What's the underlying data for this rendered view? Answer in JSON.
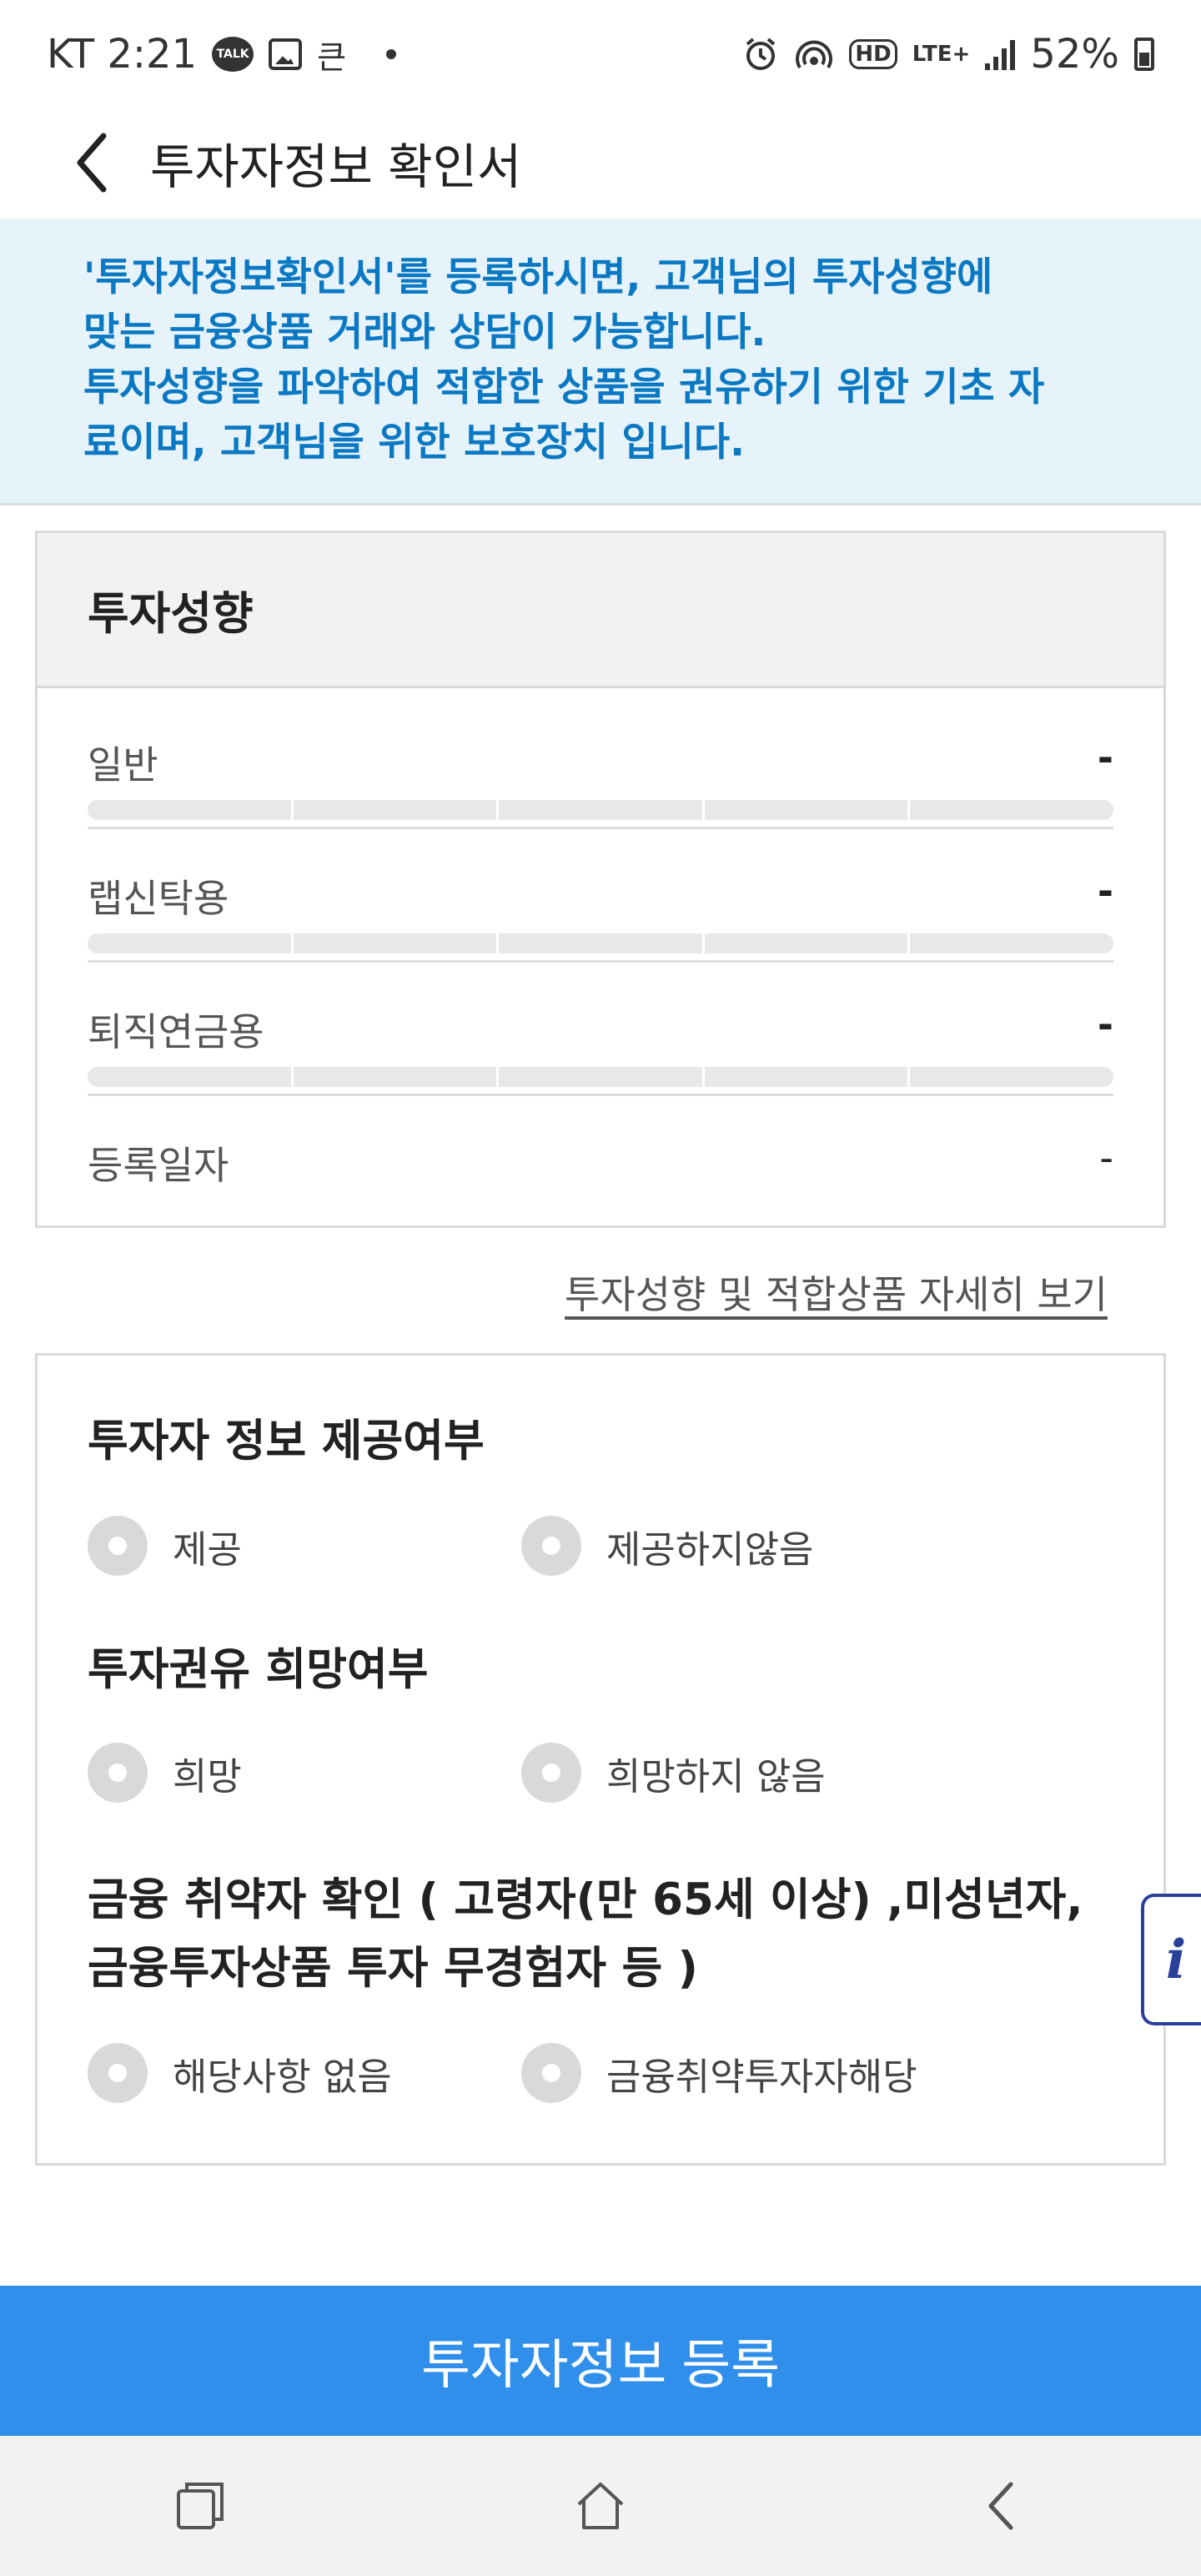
{
  "status_bar": {
    "carrier_time": "KT 2:21",
    "talk_label": "TALK",
    "extra_glyph": "큰",
    "lte_label": "LTE+",
    "battery": "52%"
  },
  "header": {
    "title": "투자자정보 확인서"
  },
  "notice": {
    "line1": "'투자자정보확인서'를 등록하시면, 고객님의 투자성향에",
    "line2": "맞는 금융상품 거래와 상담이 가능합니다.",
    "line3": "투자성향을 파악하여 적합한 상품을 권유하기 위한 기초 자",
    "line4": "료이며, 고객님을 위한 보호장치 입니다."
  },
  "tendency": {
    "title": "투자성향",
    "rows": [
      {
        "label": "일반",
        "value": "-",
        "level": 0
      },
      {
        "label": "랩신탁용",
        "value": "-",
        "level": 0
      },
      {
        "label": "퇴직연금용",
        "value": "-",
        "level": 0
      }
    ],
    "reg_date_label": "등록일자",
    "reg_date_value": "-"
  },
  "detail_link": "투자성향 및 적합상품 자세히 보기",
  "investor_info": {
    "provide": {
      "title": "투자자 정보 제공여부",
      "options": [
        "제공",
        "제공하지않음"
      ]
    },
    "solicit": {
      "title": "투자권유 희망여부",
      "options": [
        "희망",
        "희망하지 않음"
      ]
    },
    "vulnerable": {
      "title_line1": "금융 취약자 확인 ( 고령자(만 65세 이상) ,미성년자,",
      "title_line2": "금융투자상품 투자 무경험자 등 )",
      "options": [
        "해당사항 없음",
        "금융취약투자자해당"
      ]
    }
  },
  "float_info_label": "i",
  "register_button": "투자자정보 등록",
  "colors": {
    "notice_bg": "#e6f3fb",
    "notice_text": "#0a78c2",
    "button_blue": "#2f8fea",
    "float_border": "#2a3f99"
  },
  "icons": [
    "back-arrow-icon",
    "recent-apps-icon",
    "home-icon",
    "nav-back-icon",
    "alarm-icon",
    "hotspot-icon",
    "hd-icon",
    "signal-icon",
    "battery-icon"
  ]
}
